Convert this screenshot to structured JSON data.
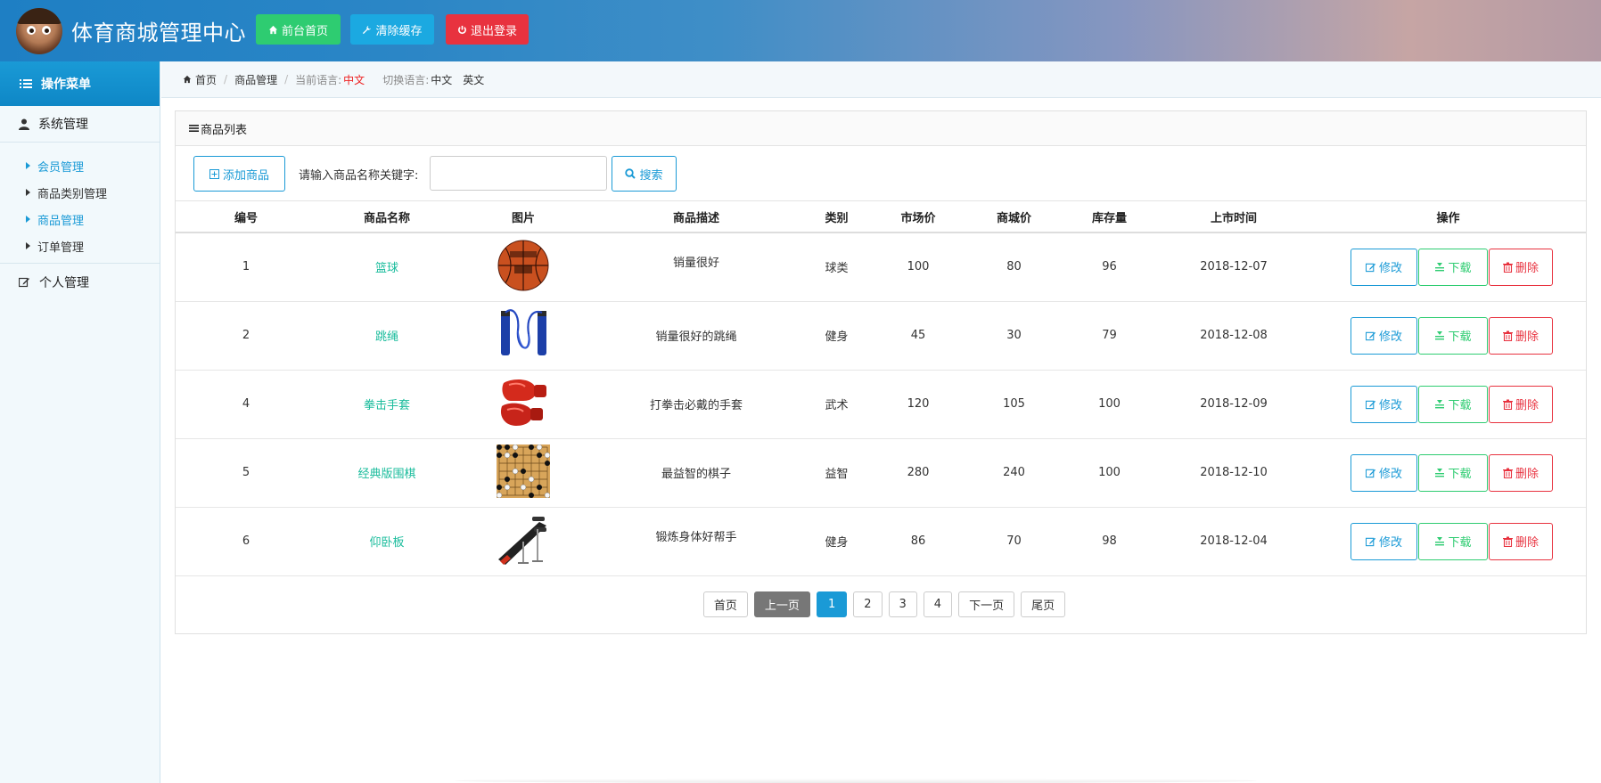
{
  "header": {
    "title": "体育商城管理中心",
    "buttons": [
      {
        "label": "前台首页",
        "icon": "home-icon"
      },
      {
        "label": "清除缓存",
        "icon": "wrench-icon"
      },
      {
        "label": "退出登录",
        "icon": "power-icon"
      }
    ]
  },
  "sidebar": {
    "menu_title": "操作菜单",
    "group_system": "系统管理",
    "items": [
      {
        "label": "会员管理",
        "active": true
      },
      {
        "label": "商品类别管理",
        "active": false
      },
      {
        "label": "商品管理",
        "active": true
      },
      {
        "label": "订单管理",
        "active": false
      }
    ],
    "group_personal": "个人管理"
  },
  "breadcrumb": {
    "home": "首页",
    "current": "商品管理",
    "lang_label": "当前语言:",
    "lang_value": "中文",
    "switch_label": "切换语言:",
    "lang_cn": "中文",
    "lang_en": "英文"
  },
  "panel": {
    "title": "商品列表",
    "add_button": "添加商品",
    "search_label": "请输入商品名称关键字:",
    "search_value": "",
    "search_button": "搜索"
  },
  "table": {
    "headers": [
      "编号",
      "商品名称",
      "图片",
      "商品描述",
      "类别",
      "市场价",
      "商城价",
      "库存量",
      "上市时间",
      "操作"
    ],
    "rows": [
      {
        "id": "1",
        "name": "篮球",
        "image": "basketball",
        "desc": "销量很好",
        "category": "球类",
        "market": "100",
        "price": "80",
        "stock": "96",
        "date": "2018-12-07"
      },
      {
        "id": "2",
        "name": "跳绳",
        "image": "jump-rope",
        "desc": "销量很好的跳绳",
        "category": "健身",
        "market": "45",
        "price": "30",
        "stock": "79",
        "date": "2018-12-08"
      },
      {
        "id": "4",
        "name": "拳击手套",
        "image": "boxing-gloves",
        "desc": "打拳击必戴的手套",
        "category": "武术",
        "market": "120",
        "price": "105",
        "stock": "100",
        "date": "2018-12-09"
      },
      {
        "id": "5",
        "name": "经典版围棋",
        "image": "go-board",
        "desc": "最益智的棋子",
        "category": "益智",
        "market": "280",
        "price": "240",
        "stock": "100",
        "date": "2018-12-10"
      },
      {
        "id": "6",
        "name": "仰卧板",
        "image": "situp-bench",
        "desc": "锻炼身体好帮手",
        "category": "健身",
        "market": "86",
        "price": "70",
        "stock": "98",
        "date": "2018-12-04"
      }
    ],
    "actions": {
      "edit": "修改",
      "download": "下载",
      "delete": "删除"
    }
  },
  "pagination": {
    "first": "首页",
    "prev": "上一页",
    "pages": [
      "1",
      "2",
      "3",
      "4"
    ],
    "current": "1",
    "next": "下一页",
    "last": "尾页"
  },
  "colors": {
    "accent": "#1a9ad6",
    "green": "#2ecc71",
    "red": "#e8323f",
    "name_link": "#1abc9c"
  }
}
